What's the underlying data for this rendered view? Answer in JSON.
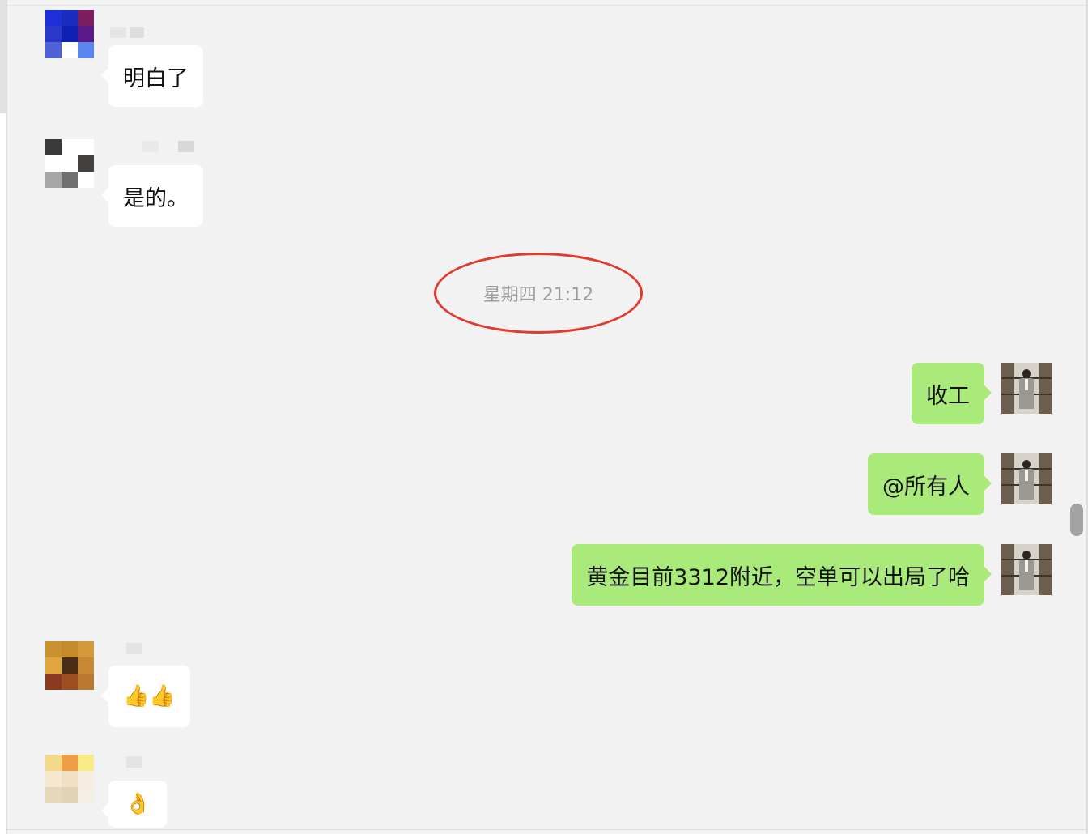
{
  "messages": [
    {
      "direction": "incoming",
      "text": "明白了"
    },
    {
      "direction": "incoming",
      "text": "是的。"
    },
    {
      "direction": "outgoing",
      "text": "收工"
    },
    {
      "direction": "outgoing",
      "text": "@所有人"
    },
    {
      "direction": "outgoing",
      "text": "黄金目前3312附近，空单可以出局了哈"
    },
    {
      "direction": "incoming",
      "text": "👍👍"
    },
    {
      "direction": "incoming",
      "text": "👌"
    }
  ],
  "time_separator": {
    "label": "星期四 21:12",
    "highlight_color": "#e23a2c"
  },
  "colors": {
    "chat_background": "#f2f2f2",
    "incoming_bubble": "#ffffff",
    "outgoing_bubble": "#a9ea7a",
    "timestamp_text": "#9c9c9c"
  },
  "icons": {
    "sender_avatar": "pixelated-avatar-icon",
    "self_avatar": "user-photo-avatar-icon"
  }
}
